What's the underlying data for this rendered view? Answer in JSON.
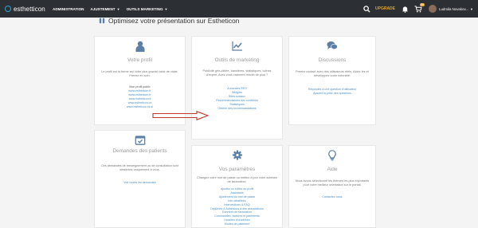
{
  "topbar": {
    "logo": "esthetticon",
    "nav": [
      "ADMINISTRATION",
      "AJUSTEMENT",
      "OUTILS MARKETING"
    ],
    "upgrade": "UPGRADE",
    "badge": "99",
    "username": "Ludmila Novakov..."
  },
  "page": {
    "title": "Optimisez votre présentation sur Estheticon"
  },
  "cards": {
    "profil": {
      "title": "Votre profil",
      "desc": "Le profil est la forme est votre plus grande carte de visite. Prenez en soin.",
      "sub": "Mon profil public",
      "links": [
        "www.estheticon.fr",
        "www.estheticon.fr",
        "www.estheticon.it",
        "www.estheticon.cz",
        "www.estheticon.cs.sl"
      ]
    },
    "marketing": {
      "title": "Outils de marketing",
      "desc": "Publicité géo-ciblée, bannières, statistiques, icônes d'expert. Avez-vous vraiment besoin de plus ?",
      "links": [
        "Annonces SEO",
        "Widgets",
        "Sites sociaux",
        "Recommandations des confrères",
        "Statistiques",
        "Obtenir des recommandations"
      ]
    },
    "discussions": {
      "title": "Discussions",
      "desc": "Prenez contact avec des utilisateurs réels. Aidez-les et développez votre notoriété.",
      "links": [
        "Répondez à une question d'utilisateur",
        "Ajoutez la prise des questions"
      ]
    },
    "demandes": {
      "title": "Demandes des patients",
      "desc": "Ces demandes de renseignement ou de consultation sont destinées uniquement à vous.",
      "links": [
        "Voir toutes les demandes"
      ]
    },
    "parametres": {
      "title": "Vos paramètres",
      "desc": "Changez votre mot de passe ou mettez à jour votre adresse de facturation.",
      "links": [
        "Ajoutez ou éditez du profil",
        "Assistants",
        "Ajustement du mot de passe",
        "Info détaillées",
        "Interventions & FAQ",
        "Diplômes & Adhésions à des associations",
        "Données de facturation",
        "Commandes, factures et paiements",
        "Horaires d'ouverture",
        "Modes de paiement"
      ]
    },
    "aide": {
      "title": "Aide",
      "desc": "Nous avons sélectionné les thèmes les plus importants pour votre meilleur orientation sur le portail.",
      "links": [
        "Contactez-nous"
      ]
    }
  },
  "colors": {
    "topbar": "#2c2f33",
    "accent": "#2ea3d8",
    "icon": "#5b7fa7",
    "link": "#4b8fc4",
    "upgrade": "#e0a12a",
    "arrow": "#c0392b"
  }
}
